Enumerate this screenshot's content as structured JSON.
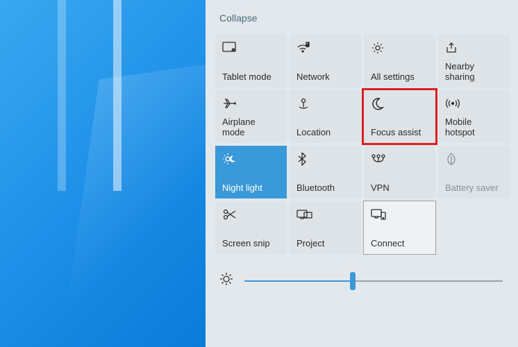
{
  "collapse_label": "Collapse",
  "tiles": {
    "tablet_mode": "Tablet mode",
    "network": "Network",
    "all_settings": "All settings",
    "nearby_sharing": "Nearby sharing",
    "airplane_mode": "Airplane mode",
    "location": "Location",
    "focus_assist": "Focus assist",
    "mobile_hotspot": "Mobile hotspot",
    "night_light": "Night light",
    "bluetooth": "Bluetooth",
    "vpn": "VPN",
    "battery_saver": "Battery saver",
    "screen_snip": "Screen snip",
    "project": "Project",
    "connect": "Connect"
  },
  "brightness_percent": 42
}
